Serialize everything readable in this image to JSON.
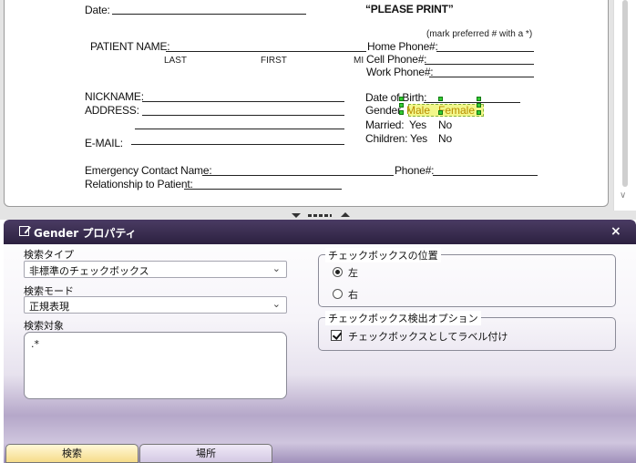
{
  "document": {
    "date_label": "Date:",
    "please_print": "“PLEASE PRINT”",
    "mark_note": "(mark preferred # with a *)",
    "patient_name_label": "PATIENT NAME:",
    "name_parts": [
      "LAST",
      "FIRST",
      "MI"
    ],
    "home_phone": "Home Phone#:",
    "cell_phone": "Cell Phone#:",
    "work_phone": "Work Phone#:",
    "nickname": "NICKNAME:",
    "address": "ADDRESS:",
    "email": "E-MAIL:",
    "dob": "Date of Birth:",
    "gender": "Gender",
    "gender_male": "Male",
    "gender_female": "Female",
    "married": "Married:",
    "children": "Children:",
    "yes": "Yes",
    "no": "No",
    "emergency_contact": "Emergency Contact Name:",
    "phone": "Phone#:",
    "relationship": "Relationship to Patient:"
  },
  "panel": {
    "title": "Gender プロパティ",
    "close": "×",
    "search_type_label": "検索タイプ",
    "search_type_value": "非標準のチェックボックス",
    "search_mode_label": "検索モード",
    "search_mode_value": "正規表現",
    "search_target_label": "検索対象",
    "search_target_value": ".*",
    "checkbox_position_title": "チェックボックスの位置",
    "position_left": "左",
    "position_right": "右",
    "checkbox_position_selected": "左",
    "detect_options_title": "チェックボックス検出オプション",
    "label_as_checkbox": "チェックボックスとしてラベル付け",
    "label_as_checkbox_checked": true
  },
  "tabs": [
    {
      "label": "検索",
      "active": true
    },
    {
      "label": "場所",
      "active": false
    }
  ],
  "icons": {
    "title_icon": "edit-checkbox-icon",
    "close": "close-icon",
    "chevron": "chevron-down-icon",
    "splitter_down": "collapse-down-icon",
    "splitter_up": "expand-up-icon"
  }
}
